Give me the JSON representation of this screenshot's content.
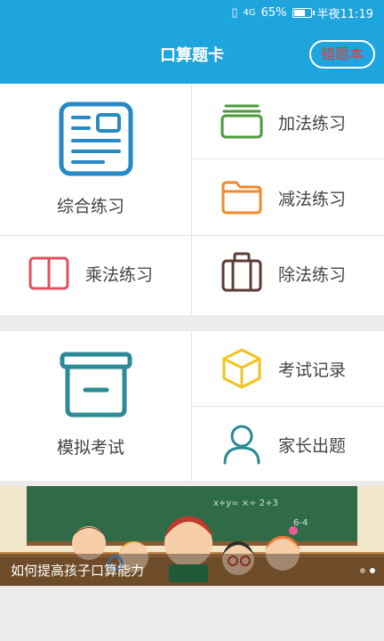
{
  "status_bar": {
    "signal": "4G",
    "battery": "65%",
    "battery_level": 0.65,
    "time": "半夜11:19"
  },
  "header": {
    "title": "口算题卡",
    "wrong_book_label": "错题本"
  },
  "menu": {
    "comprehensive": "综合练习",
    "addition": "加法练习",
    "subtraction": "减法练习",
    "multiplication": "乘法练习",
    "division": "除法练习",
    "mock_exam": "模拟考试",
    "exam_records": "考试记录",
    "parent_questions": "家长出题"
  },
  "banner": {
    "caption": "如何提高孩子口算能力",
    "slides": 2,
    "active_slide": 1
  },
  "colors": {
    "primary": "#1fa5dd",
    "wrong_book_text": "#e43a3a",
    "icon_blue": "#2789c6",
    "icon_green": "#4a9a3a",
    "icon_orange": "#f08a2a",
    "icon_red": "#e05060",
    "icon_brown": "#5a3d35",
    "icon_teal": "#2a8a96",
    "icon_yellow": "#f2c21e"
  }
}
